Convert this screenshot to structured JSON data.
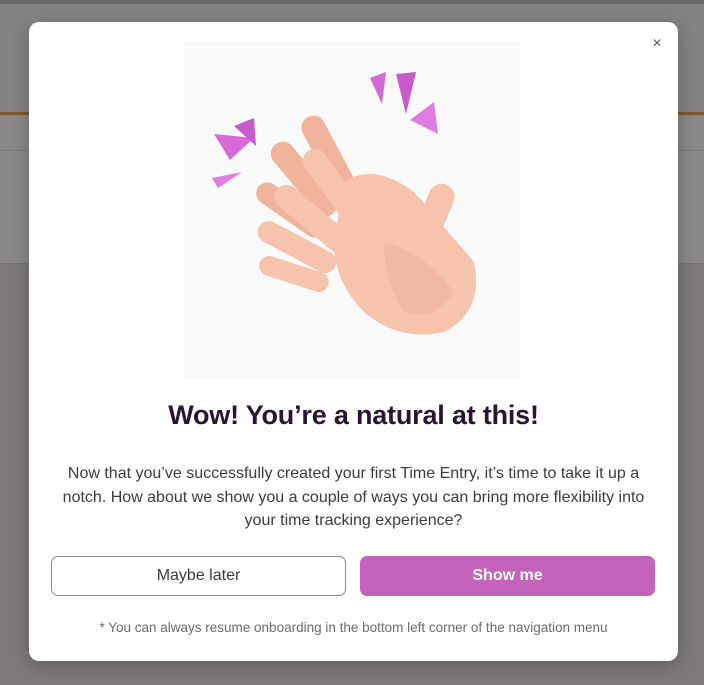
{
  "dialog": {
    "close_label": "×",
    "title": "Wow! You’re a natural at this!",
    "body": "Now that you’ve successfully created your first Time Entry, it’s time to take it up a notch. How about we show you a couple of ways you can bring more flexibility into your time tracking experience?",
    "buttons": {
      "later": "Maybe later",
      "show": "Show me"
    },
    "footnote": "* You can always resume onboarding in the bottom left corner of the navigation menu",
    "illustration": "clapping-hands-icon"
  },
  "colors": {
    "primary": "#c463ba",
    "title": "#2a1433",
    "overlay": "#7d7a79",
    "accent_line": "#7a5a2e"
  }
}
